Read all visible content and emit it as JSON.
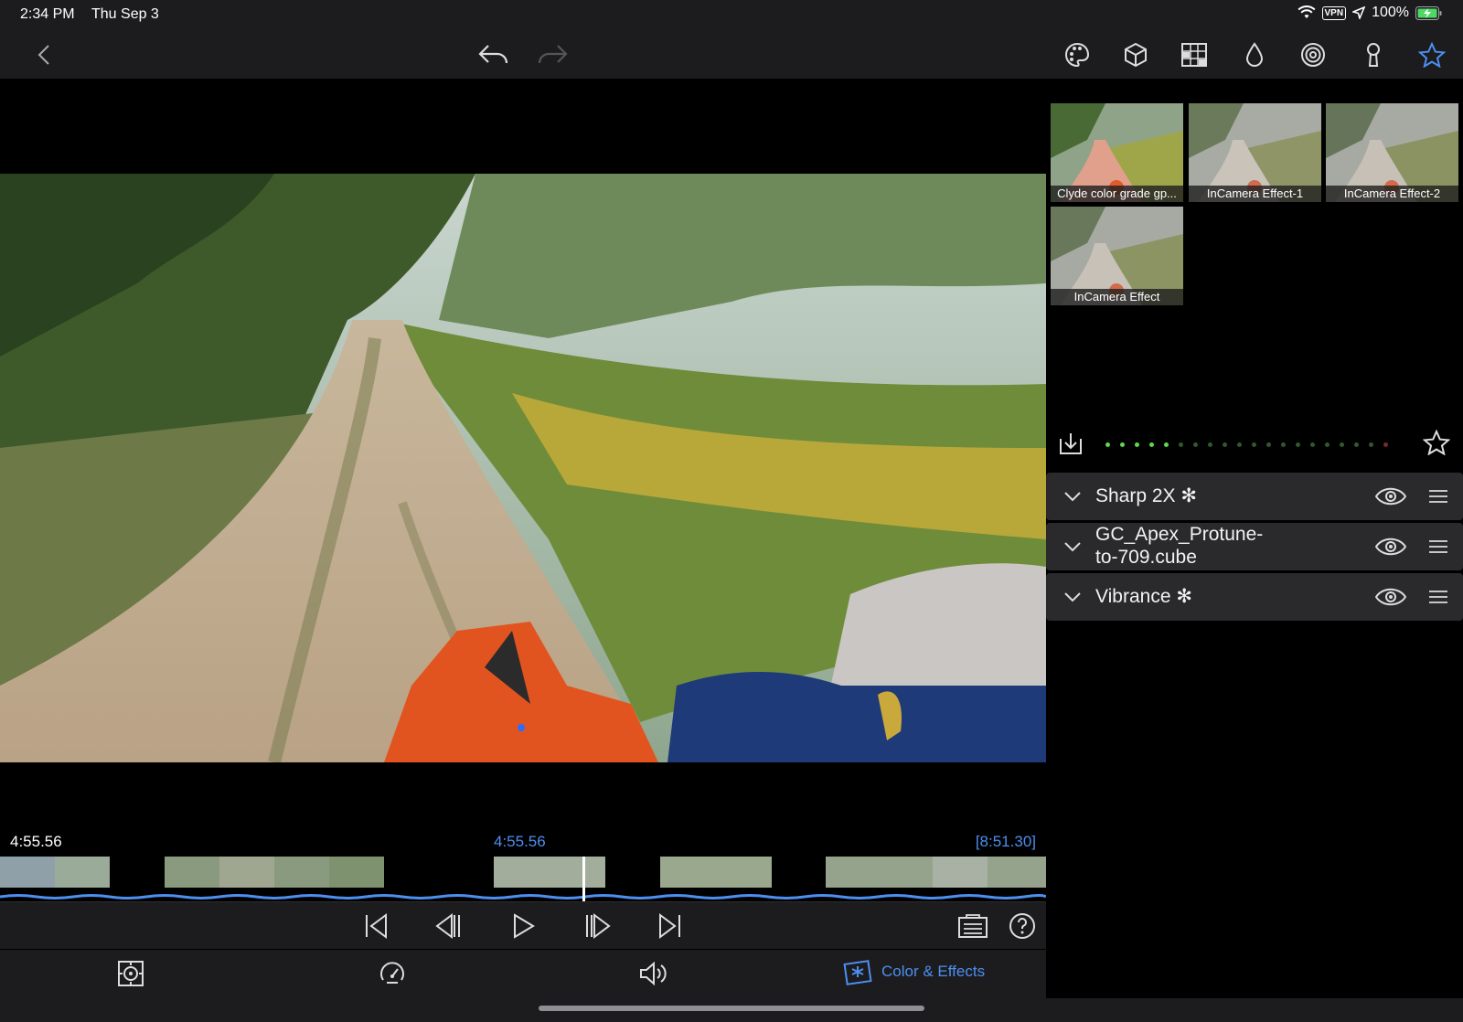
{
  "status_bar": {
    "time": "2:34 PM",
    "date": "Thu Sep 3",
    "vpn": "VPN",
    "battery": "100%"
  },
  "toolbar": {
    "icons": [
      "back-chevron-icon",
      "undo-icon",
      "redo-icon",
      "palette-icon",
      "cube-icon",
      "grid-icon",
      "drop-icon",
      "spiral-icon",
      "keyhole-icon",
      "star-icon"
    ]
  },
  "presets": [
    {
      "label": "Clyde color grade gp..."
    },
    {
      "label": "InCamera Effect-1"
    },
    {
      "label": "InCamera Effect-2"
    },
    {
      "label": "InCamera Effect"
    }
  ],
  "effects": [
    {
      "name": "Sharp 2X ✻"
    },
    {
      "name_line1": "GC_Apex_Protune-",
      "name_line2": "to-709.cube"
    },
    {
      "name": "Vibrance ✻"
    }
  ],
  "timeline": {
    "left_time": "4:55.56",
    "playhead_time": "4:55.56",
    "duration": "[8:51.30]"
  },
  "tabs": {
    "color_effects_label": "Color & Effects"
  },
  "colors": {
    "accent": "#4d8ff0",
    "chrome": "#1c1c1e",
    "dot_active": "#5dd94a",
    "dot_inactive": "#2f5a2a",
    "dot_red": "#7a2a2a"
  }
}
